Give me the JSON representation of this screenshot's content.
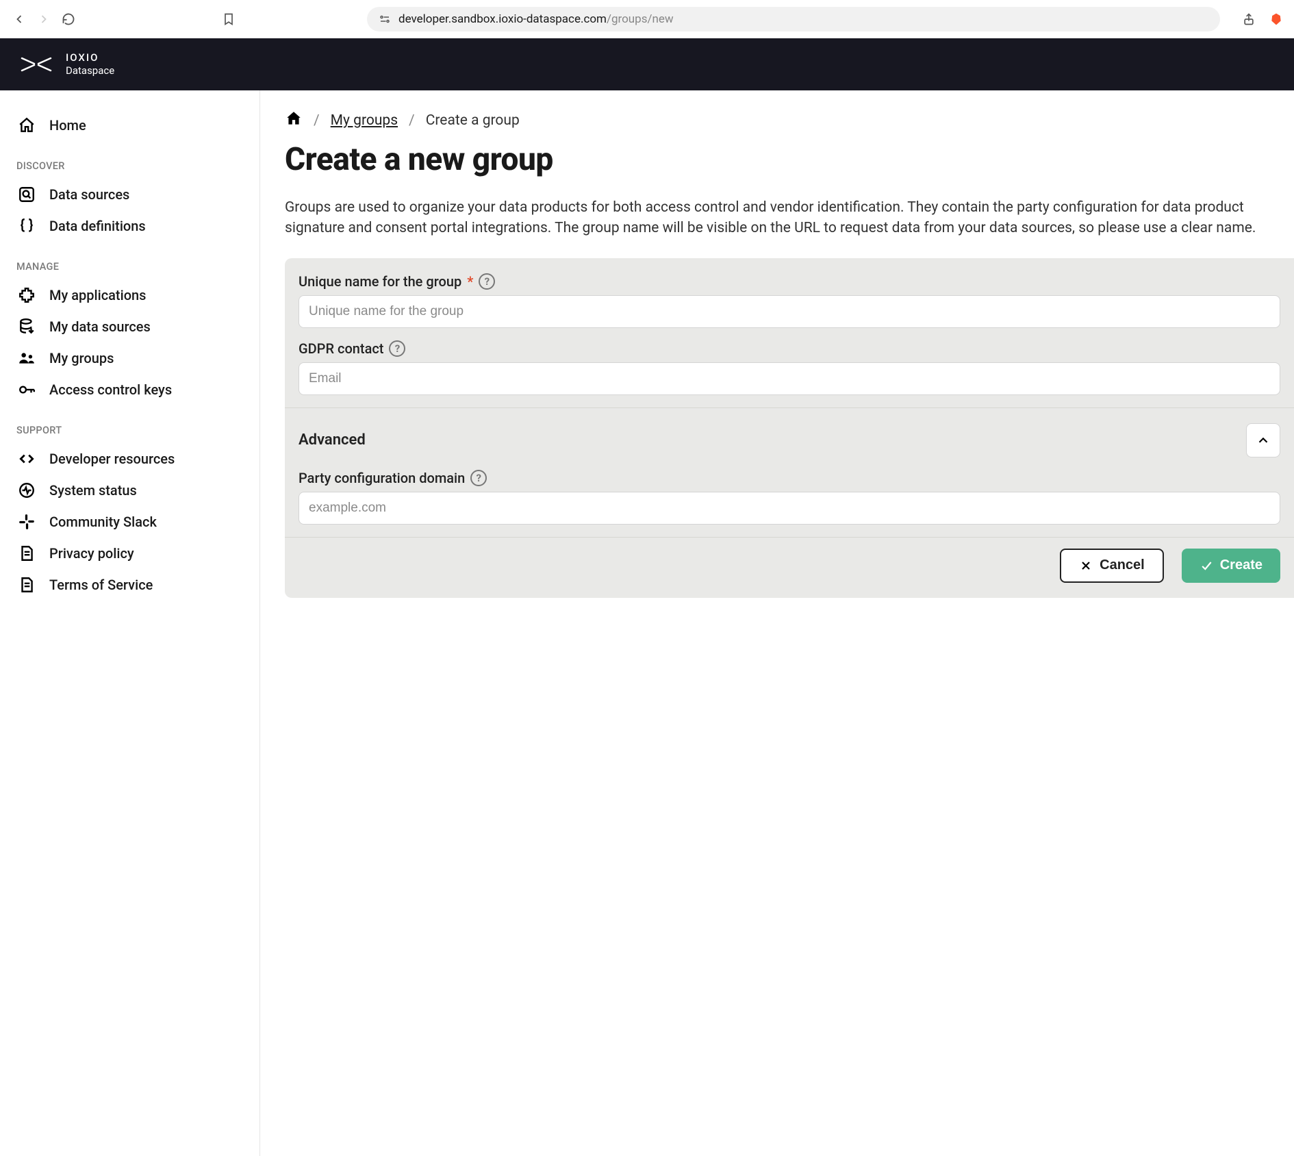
{
  "browser": {
    "url_domain": "developer.sandbox.ioxio-dataspace.com",
    "url_path": "/groups/new"
  },
  "header": {
    "brand_line1": "IOXIO",
    "brand_line2": "Dataspace"
  },
  "sidebar": {
    "home": "Home",
    "discover_title": "DISCOVER",
    "discover": {
      "data_sources": "Data sources",
      "data_definitions": "Data definitions"
    },
    "manage_title": "MANAGE",
    "manage": {
      "my_applications": "My applications",
      "my_data_sources": "My data sources",
      "my_groups": "My groups",
      "access_keys": "Access control keys"
    },
    "support_title": "SUPPORT",
    "support": {
      "dev_resources": "Developer resources",
      "system_status": "System status",
      "community_slack": "Community Slack",
      "privacy_policy": "Privacy policy",
      "terms": "Terms of Service"
    }
  },
  "breadcrumb": {
    "my_groups": "My groups",
    "current": "Create a group"
  },
  "page": {
    "title": "Create a new group",
    "description": "Groups are used to organize your data products for both access control and vendor identification. They contain the party configuration for data product signature and consent portal integrations. The group name will be visible on the URL to request data from your data sources, so please use a clear name."
  },
  "form": {
    "name_label": "Unique name for the group",
    "name_placeholder": "Unique name for the group",
    "gdpr_label": "GDPR contact",
    "gdpr_placeholder": "Email",
    "advanced_title": "Advanced",
    "party_domain_label": "Party configuration domain",
    "party_domain_placeholder": "example.com",
    "cancel": "Cancel",
    "create": "Create"
  }
}
